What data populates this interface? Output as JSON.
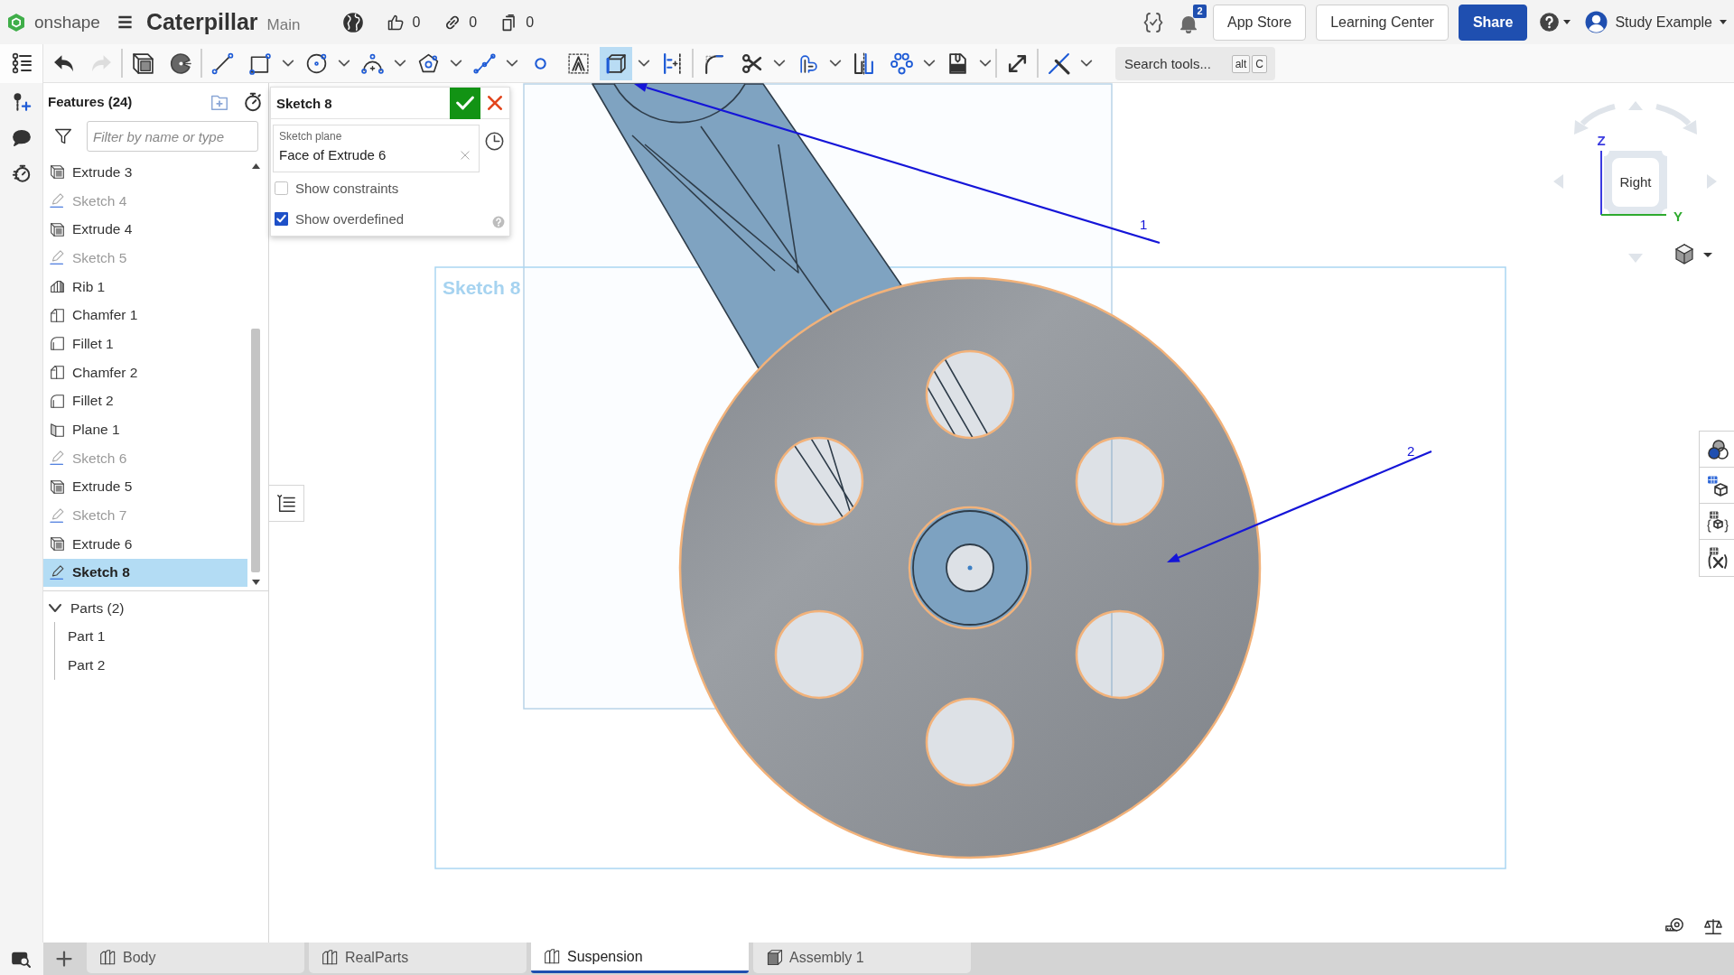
{
  "header": {
    "brand": "onshape",
    "document_title": "Caterpillar",
    "branch": "Main",
    "stats": [
      {
        "kind": "likes",
        "count": "0"
      },
      {
        "kind": "links",
        "count": "0"
      },
      {
        "kind": "copies",
        "count": "0"
      }
    ],
    "notification_count": "2",
    "buttons": [
      {
        "label": "App Store",
        "kind": "secondary"
      },
      {
        "label": "Learning Center",
        "kind": "secondary"
      },
      {
        "label": "Share",
        "kind": "primary"
      }
    ],
    "user_name": "Study Example"
  },
  "toolbar": {
    "groups": [
      {
        "tools": [
          {
            "kind": "undo",
            "dropdown": false,
            "selected": false,
            "disabled": false
          },
          {
            "kind": "redo",
            "dropdown": false,
            "selected": false,
            "disabled": true
          }
        ]
      },
      {
        "tools": [
          {
            "kind": "extrude",
            "dropdown": false,
            "selected": false,
            "disabled": false
          },
          {
            "kind": "revolve",
            "dropdown": false,
            "selected": false,
            "disabled": false
          }
        ]
      },
      {
        "tools": [
          {
            "kind": "line",
            "dropdown": false,
            "selected": false,
            "disabled": false
          },
          {
            "kind": "rectangle",
            "dropdown": true,
            "selected": false,
            "disabled": false
          },
          {
            "kind": "circle",
            "dropdown": true,
            "selected": false,
            "disabled": false
          },
          {
            "kind": "arc",
            "dropdown": true,
            "selected": false,
            "disabled": false
          },
          {
            "kind": "polygon",
            "dropdown": true,
            "selected": false,
            "disabled": false
          },
          {
            "kind": "spline",
            "dropdown": true,
            "selected": false,
            "disabled": false
          },
          {
            "kind": "point",
            "dropdown": false,
            "selected": false,
            "disabled": false
          },
          {
            "kind": "text",
            "dropdown": false,
            "selected": false,
            "disabled": false
          },
          {
            "kind": "use",
            "dropdown": true,
            "selected": true,
            "disabled": false
          },
          {
            "kind": "dimension",
            "dropdown": false,
            "selected": false,
            "disabled": false
          }
        ]
      },
      {
        "tools": [
          {
            "kind": "fillet",
            "dropdown": false,
            "selected": false,
            "disabled": false
          },
          {
            "kind": "trim",
            "dropdown": true,
            "selected": false,
            "disabled": false
          },
          {
            "kind": "offset",
            "dropdown": true,
            "selected": false,
            "disabled": false
          },
          {
            "kind": "mirror",
            "dropdown": false,
            "selected": false,
            "disabled": false
          },
          {
            "kind": "pattern",
            "dropdown": true,
            "selected": false,
            "disabled": false
          },
          {
            "kind": "dxf",
            "dropdown": true,
            "selected": false,
            "disabled": false
          }
        ]
      },
      {
        "tools": [
          {
            "kind": "transform",
            "dropdown": false,
            "selected": false,
            "disabled": false
          }
        ]
      },
      {
        "tools": [
          {
            "kind": "construction",
            "dropdown": true,
            "selected": false,
            "disabled": false
          }
        ]
      }
    ],
    "search": {
      "placeholder": "Search tools...",
      "shortcut": [
        "alt",
        "C"
      ]
    }
  },
  "feature_panel": {
    "title": "Features (24)",
    "filter": {
      "placeholder": "Filter by name or type"
    },
    "features": [
      {
        "name": "Extrude 3",
        "kind": "extrude",
        "hidden": false,
        "selected": false
      },
      {
        "name": "Sketch 4",
        "kind": "sketch",
        "hidden": true,
        "selected": false
      },
      {
        "name": "Extrude 4",
        "kind": "extrude",
        "hidden": false,
        "selected": false
      },
      {
        "name": "Sketch 5",
        "kind": "sketch",
        "hidden": true,
        "selected": false
      },
      {
        "name": "Rib 1",
        "kind": "rib",
        "hidden": false,
        "selected": false
      },
      {
        "name": "Chamfer 1",
        "kind": "chamfer",
        "hidden": false,
        "selected": false
      },
      {
        "name": "Fillet 1",
        "kind": "fillet",
        "hidden": false,
        "selected": false
      },
      {
        "name": "Chamfer 2",
        "kind": "chamfer",
        "hidden": false,
        "selected": false
      },
      {
        "name": "Fillet 2",
        "kind": "fillet",
        "hidden": false,
        "selected": false
      },
      {
        "name": "Plane 1",
        "kind": "plane",
        "hidden": false,
        "selected": false
      },
      {
        "name": "Sketch 6",
        "kind": "sketch",
        "hidden": true,
        "selected": false
      },
      {
        "name": "Extrude 5",
        "kind": "extrude",
        "hidden": false,
        "selected": false
      },
      {
        "name": "Sketch 7",
        "kind": "sketch",
        "hidden": true,
        "selected": false
      },
      {
        "name": "Extrude 6",
        "kind": "extrude",
        "hidden": false,
        "selected": false
      },
      {
        "name": "Sketch 8",
        "kind": "sketch",
        "hidden": false,
        "selected": true
      }
    ],
    "parts": {
      "label": "Parts (2)",
      "expanded": true,
      "children": [
        {
          "label": "Part 1"
        },
        {
          "label": "Part 2"
        }
      ]
    }
  },
  "sketch_dialog": {
    "title": "Sketch 8",
    "plane_field": {
      "label": "Sketch plane",
      "value": "Face of Extrude 6"
    },
    "options": [
      {
        "label": "Show constraints",
        "checked": false
      },
      {
        "label": "Show overdefined",
        "checked": true
      }
    ]
  },
  "viewport": {
    "sketch_label": "Sketch 8",
    "annotations": [
      {
        "label": "1"
      },
      {
        "label": "2"
      }
    ],
    "view_cube": {
      "face": "Right",
      "axes": [
        {
          "label": "Z"
        },
        {
          "label": "Y"
        }
      ]
    }
  },
  "tabs": [
    {
      "label": "Body",
      "kind": "part_studio",
      "selected": false
    },
    {
      "label": "RealParts",
      "kind": "part_studio",
      "selected": false
    },
    {
      "label": "Suspension",
      "kind": "part_studio",
      "selected": true
    },
    {
      "label": "Assembly 1",
      "kind": "assembly",
      "selected": false
    }
  ]
}
